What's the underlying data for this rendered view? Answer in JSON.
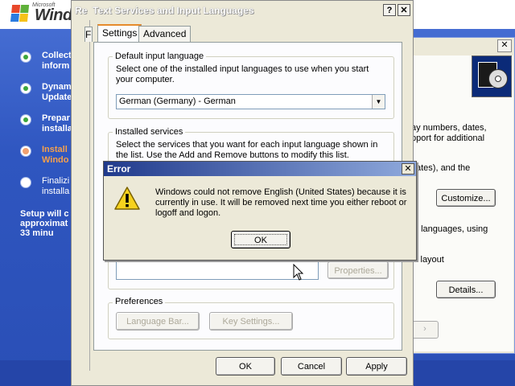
{
  "setup": {
    "logo_small": "Microsoft",
    "logo_text": "Windo",
    "steps": [
      {
        "label": "Collect\ninform",
        "state": "done"
      },
      {
        "label": "Dynam\nUpdate",
        "state": "done"
      },
      {
        "label": "Prepar\ninstalla",
        "state": "done"
      },
      {
        "label": "Install\nWindo",
        "state": "current"
      },
      {
        "label": "Finalizi\ninstalla",
        "state": "pending"
      }
    ],
    "time_remaining": "Setup will c\napproximat\n33 minu"
  },
  "regional": {
    "close_glyph": "✕",
    "text1": "ay numbers, dates,\npport for additional",
    "text2": "ates), and the",
    "customize_label": "Customize...",
    "text3": "t languages, using",
    "text4": "l layout",
    "details_label": "Details..."
  },
  "text_services": {
    "title_prefix": "Re",
    "title": "Text Services and Input Languages",
    "help_glyph": "?",
    "close_glyph": "✕",
    "side_letter": "F",
    "tabs": {
      "settings": "Settings",
      "advanced": "Advanced"
    },
    "default_group_label": "Default input language",
    "default_desc": "Select one of the installed input languages to use when you start your computer.",
    "default_value": "German (Germany) - German",
    "installed_group_label": "Installed services",
    "installed_desc": "Select the services that you want for each input language shown in the list. Use the Add and Remove buttons to modify this list.",
    "properties_label": "Properties...",
    "preferences_label": "Preferences",
    "language_bar_label": "Language Bar...",
    "key_settings_label": "Key Settings...",
    "ok_label": "OK",
    "cancel_label": "Cancel",
    "apply_label": "Apply"
  },
  "error_dialog": {
    "title": "Error",
    "close_glyph": "✕",
    "message": "Windows could not remove English (United States) because it is currently in use. It will be removed next time you either reboot or logoff and logon.",
    "ok_label": "OK"
  }
}
